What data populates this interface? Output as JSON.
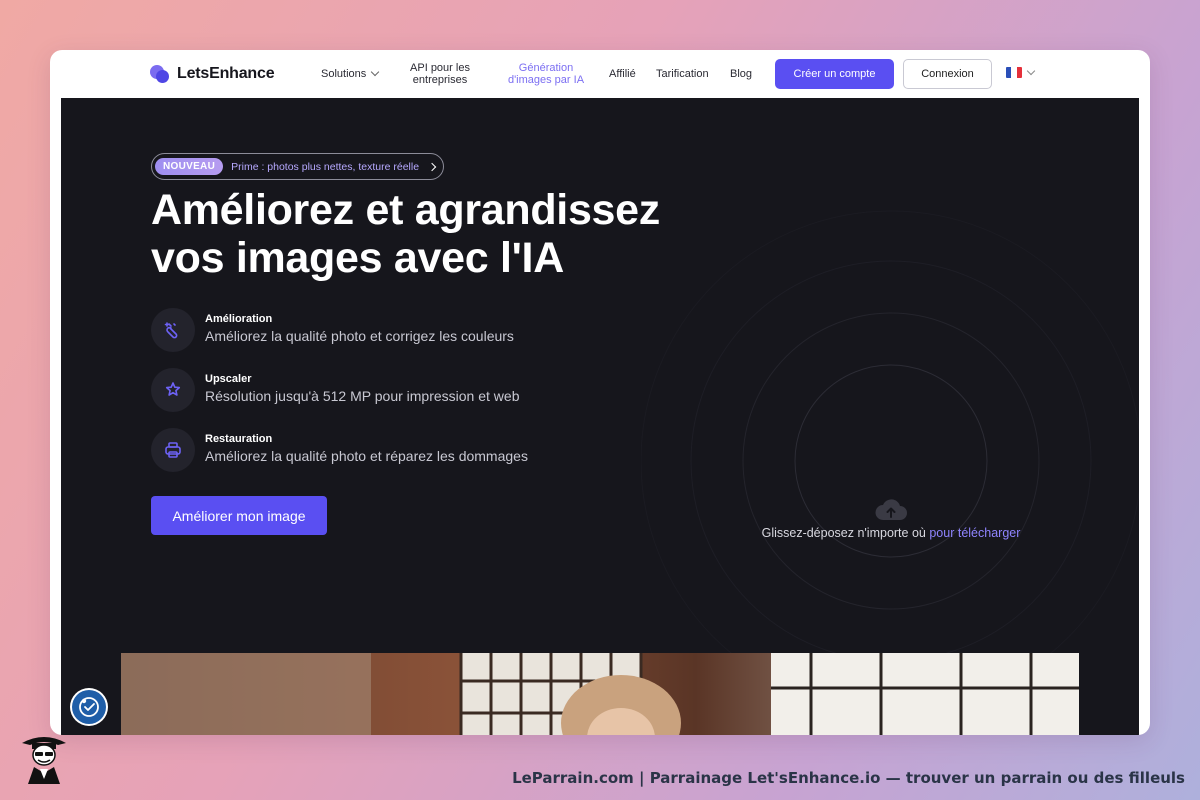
{
  "brand": {
    "name": "LetsEnhance"
  },
  "nav": {
    "solutions": "Solutions",
    "api_line1": "API pour les",
    "api_line2": "entreprises",
    "ai_line1": "Génération",
    "ai_line2": "d'images par IA",
    "affiliate": "Affilié",
    "pricing": "Tarification",
    "blog": "Blog",
    "signup": "Créer un compte",
    "login": "Connexion"
  },
  "hero": {
    "badge_tag": "NOUVEAU",
    "badge_text": "Prime : photos plus nettes, texture réelle",
    "title_line1": "Améliorez et agrandissez",
    "title_line2": "vos images avec l'IA",
    "features": [
      {
        "name": "Amélioration",
        "desc": "Améliorez la qualité photo et corrigez les couleurs",
        "icon": "magic-wand-icon"
      },
      {
        "name": "Upscaler",
        "desc": "Résolution jusqu'à 512 MP pour impression et web",
        "icon": "star-sparkle-icon"
      },
      {
        "name": "Restauration",
        "desc": "Améliorez la qualité photo et réparez les dommages",
        "icon": "printer-icon"
      }
    ],
    "cta": "Améliorer mon image",
    "drop_text": "Glissez-déposez n'importe où",
    "drop_link": "pour télécharger"
  },
  "footer": {
    "caption": "LeParrain.com | Parrainage Let'sEnhance.io — trouver un parrain ou des filleuls"
  },
  "colors": {
    "accent": "#5a4ff2",
    "hero_bg": "#16161c",
    "link": "#8f84ff"
  }
}
